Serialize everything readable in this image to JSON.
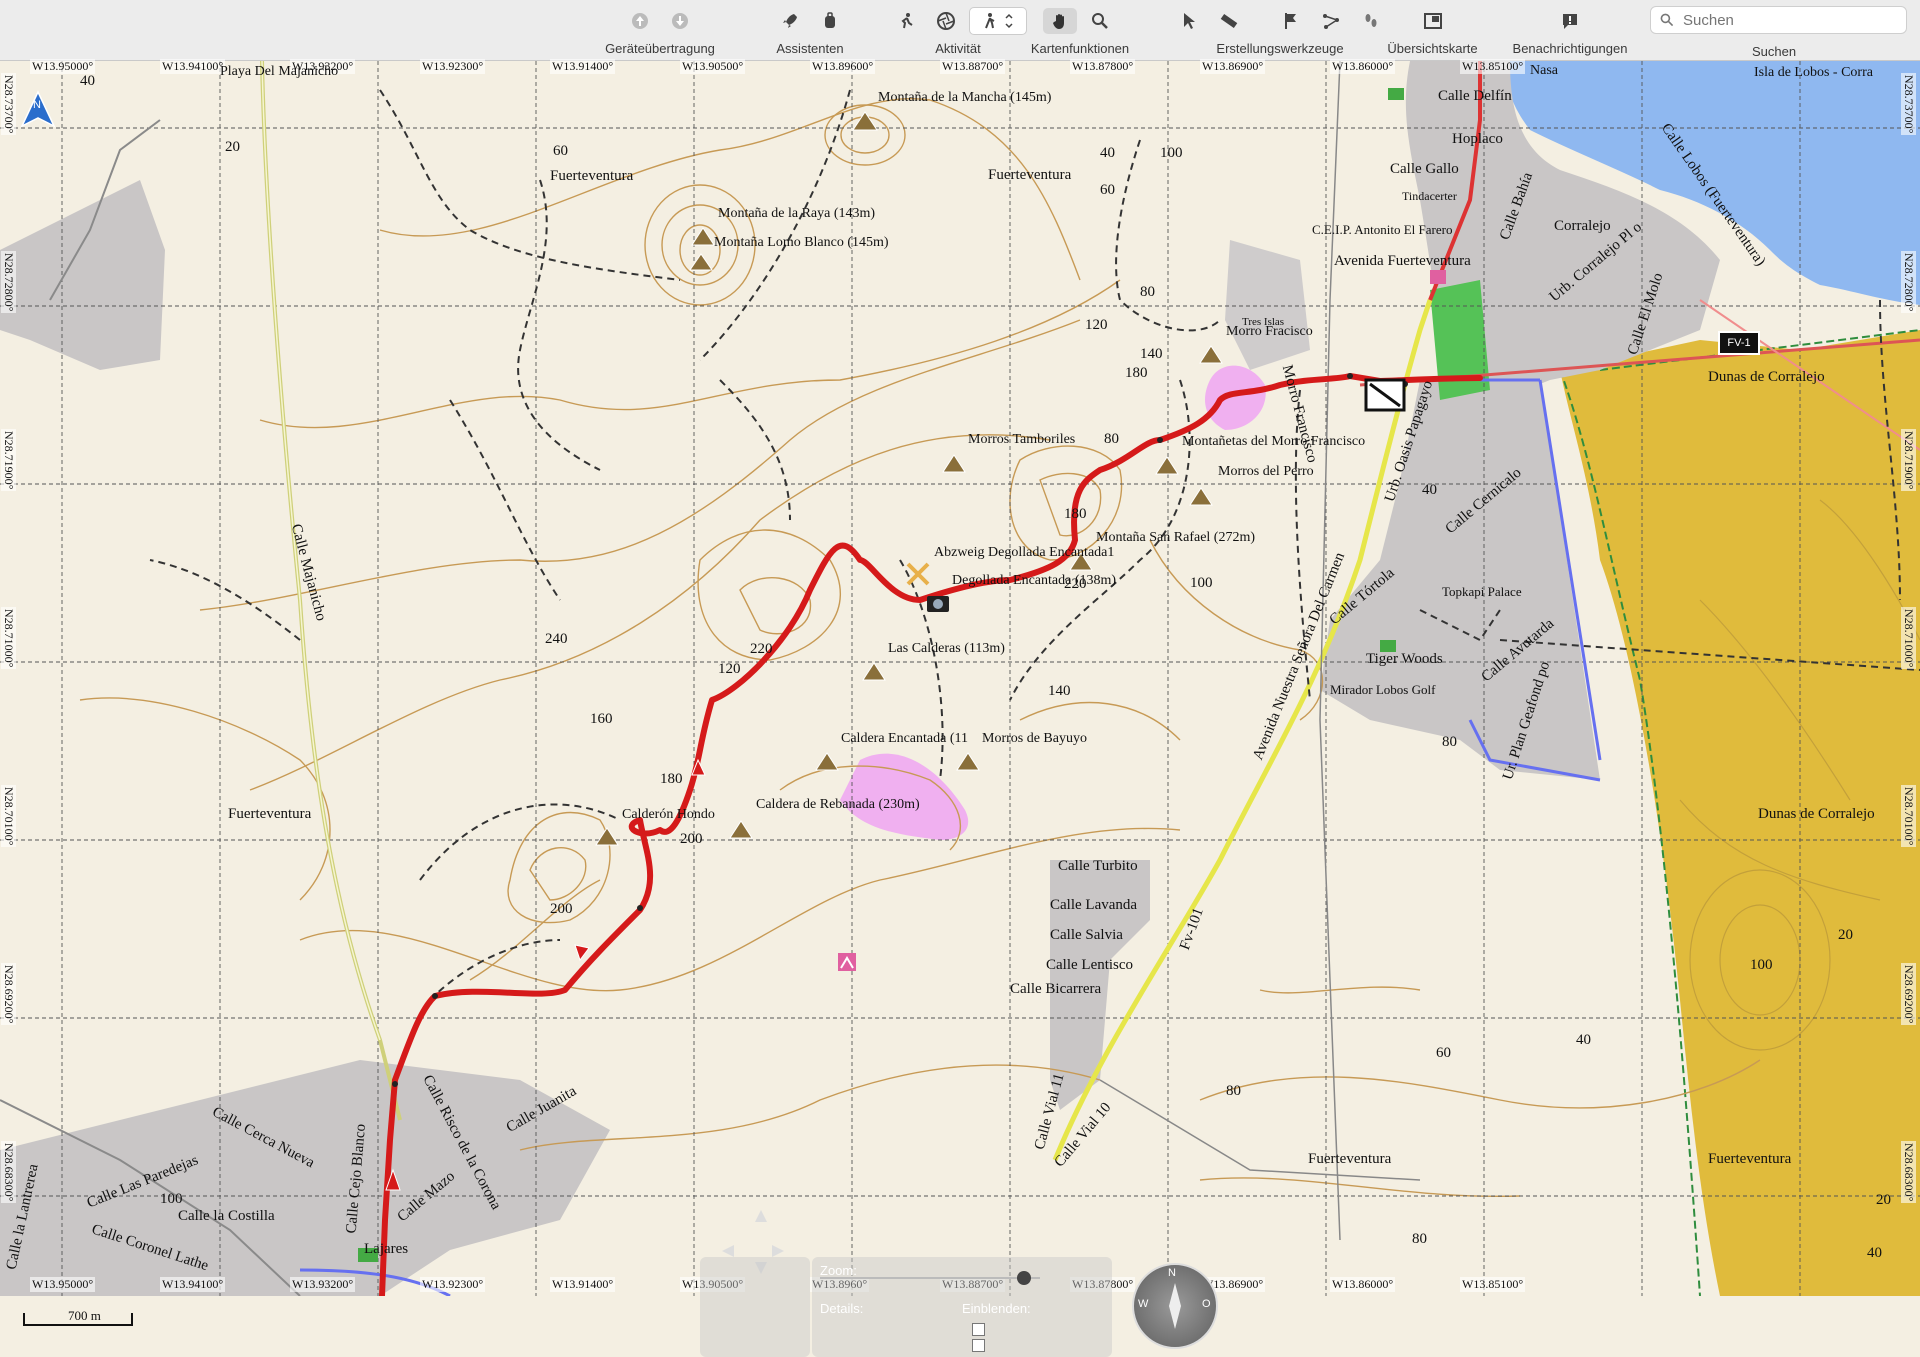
{
  "toolbar": {
    "groups": [
      {
        "label": "Geräteübertragung",
        "icons": [
          "upload-icon",
          "download-icon"
        ]
      },
      {
        "label": "Assistenten",
        "icons": [
          "rocket-icon",
          "backpack-icon"
        ]
      },
      {
        "label": "Aktivität",
        "icons": [
          "running-icon",
          "aperture-icon",
          "hiker-select-icon"
        ]
      },
      {
        "label": "Kartenfunktionen",
        "icons": [
          "hand-icon",
          "magnifier-icon"
        ]
      },
      {
        "label": "Erstellungswerkzeuge",
        "icons": [
          "arrow-pointer-icon",
          "ruler-icon",
          "flag-icon",
          "route-icon",
          "footprints-icon"
        ]
      },
      {
        "label": "Übersichtskarte",
        "icons": [
          "overview-map-icon"
        ]
      },
      {
        "label": "Benachrichtigungen",
        "icons": [
          "alert-icon"
        ]
      },
      {
        "label": "Suchen",
        "icons": []
      }
    ],
    "search_placeholder": "Suchen"
  },
  "map": {
    "grid_longitudes": [
      "W13.95000°",
      "W13.94100°",
      "W13.93200°",
      "W13.92300°",
      "W13.91400°",
      "W13.90500°",
      "W13.89600°",
      "W13.88700°",
      "W13.87800°",
      "W13.86900°",
      "W13.86000°",
      "W13.85100°"
    ],
    "bottom_longitudes": [
      "W13.95000°",
      "W13.94100°",
      "W13.93200°",
      "W13.92300°",
      "W13.91400°",
      "W13.90500°",
      "W13.8960°",
      "W13.88700°",
      "W13.87800°",
      "W13.86900°",
      "W13.86000°",
      "W13.85100°"
    ],
    "grid_latitudes": [
      "N28.73700°",
      "N28.72800°",
      "N28.71900°",
      "N28.71000°",
      "N28.70100°",
      "N28.69200°",
      "N28.68300°"
    ],
    "places": [
      {
        "text": "Playa Del Majanicho"
      },
      {
        "text": "Montaña de la Mancha (145m)"
      },
      {
        "text": "Fuerteventura"
      },
      {
        "text": "Fuerteventura"
      },
      {
        "text": "Montaña de la Raya (143m)"
      },
      {
        "text": "Montaña Lomo Blanco (145m)"
      },
      {
        "text": "Calle Delfín"
      },
      {
        "text": "Hoplaco"
      },
      {
        "text": "Calle Gallo"
      },
      {
        "text": "Tindacerter"
      },
      {
        "text": "Corralejo"
      },
      {
        "text": "C.E.I.P. Antonito El Farero"
      },
      {
        "text": "Avenida Fuerteventura"
      },
      {
        "text": "Morro Fracisco"
      },
      {
        "text": "Tres Islas"
      },
      {
        "text": "Dunas de Corralejo"
      },
      {
        "text": "Morros Tamboriles"
      },
      {
        "text": "Montañetas del Morro Francisco"
      },
      {
        "text": "Morros del Perro"
      },
      {
        "text": "Montaña San Rafael (272m)"
      },
      {
        "text": "Abzweig Degollada Encantada1"
      },
      {
        "text": "Degollada Encantada (138m)"
      },
      {
        "text": "Las Calderas (113m)"
      },
      {
        "text": "Topkapi Palace"
      },
      {
        "text": "Tiger Woods"
      },
      {
        "text": "Mirador Lobos Golf"
      },
      {
        "text": "Caldera Encantada (11"
      },
      {
        "text": "Morros de Bayuyo"
      },
      {
        "text": "Calderón Hondo"
      },
      {
        "text": "Caldera de Rebanada (230m)"
      },
      {
        "text": "Fuerteventura"
      },
      {
        "text": "Dunas de Corralejo"
      },
      {
        "text": "Calle Turbito"
      },
      {
        "text": "Calle Lavanda"
      },
      {
        "text": "Calle Salvia"
      },
      {
        "text": "Calle Lentisco"
      },
      {
        "text": "Calle Bicarrera"
      },
      {
        "text": "Fuerteventura"
      },
      {
        "text": "Fuerteventura"
      },
      {
        "text": "Lajares"
      },
      {
        "text": "Nasa"
      },
      {
        "text": "Isla de Lobos - Corra"
      }
    ],
    "streets": [
      {
        "text": "Calle Majanicho"
      },
      {
        "text": "Avenida Nuestra Señora Del Carmen"
      },
      {
        "text": "Urb. Oasis Papagayo"
      },
      {
        "text": "Calle Cernícalo"
      },
      {
        "text": "Calle Tórtola"
      },
      {
        "text": "Calle Avutarda"
      },
      {
        "text": "Ur. Plan Geafond po"
      },
      {
        "text": "Calle El Molo"
      },
      {
        "text": "Calle Bahía"
      },
      {
        "text": "Urb. Corralejo Pl o"
      },
      {
        "text": "Calle Cejo Blanco"
      },
      {
        "text": "Calle Risco de la Corona"
      },
      {
        "text": "Calle Juanita"
      },
      {
        "text": "Calle Cerca Nueva"
      },
      {
        "text": "Calle Las Paredejas"
      },
      {
        "text": "Calle Mazo"
      },
      {
        "text": "Calle la Costilla"
      },
      {
        "text": "Calle Coronel Lathe"
      },
      {
        "text": "Calle la Lantrerea"
      },
      {
        "text": "Calle Vial 11"
      },
      {
        "text": "Calle Vial 10"
      },
      {
        "text": "Fv-101"
      },
      {
        "text": "Morro Francisco"
      },
      {
        "text": "Calle Lobos (Fuerteventura)"
      }
    ],
    "contour_labels": [
      "40",
      "20",
      "60",
      "40",
      "60",
      "100",
      "120",
      "80",
      "140",
      "180",
      "240",
      "200",
      "160",
      "200",
      "220",
      "180",
      "120",
      "80",
      "180",
      "220",
      "100",
      "140",
      "40",
      "80",
      "60",
      "80",
      "40",
      "100",
      "20",
      "20",
      "80",
      "40",
      "100"
    ],
    "road_shield": "FV-1",
    "scale_label": "700 m"
  },
  "controls": {
    "zoom_label": "Zoom:",
    "details_label": "Details:",
    "layers_label": "Einblenden:",
    "compass_letters": [
      "N",
      "W",
      "O"
    ]
  },
  "colors": {
    "land": "#f4efe2",
    "water": "#8fb8f0",
    "dunes": "#e0bb3c",
    "urban": "#c9c6c6",
    "track": "#d51a1a",
    "contour": "#c79a55",
    "grid": "#555555"
  }
}
